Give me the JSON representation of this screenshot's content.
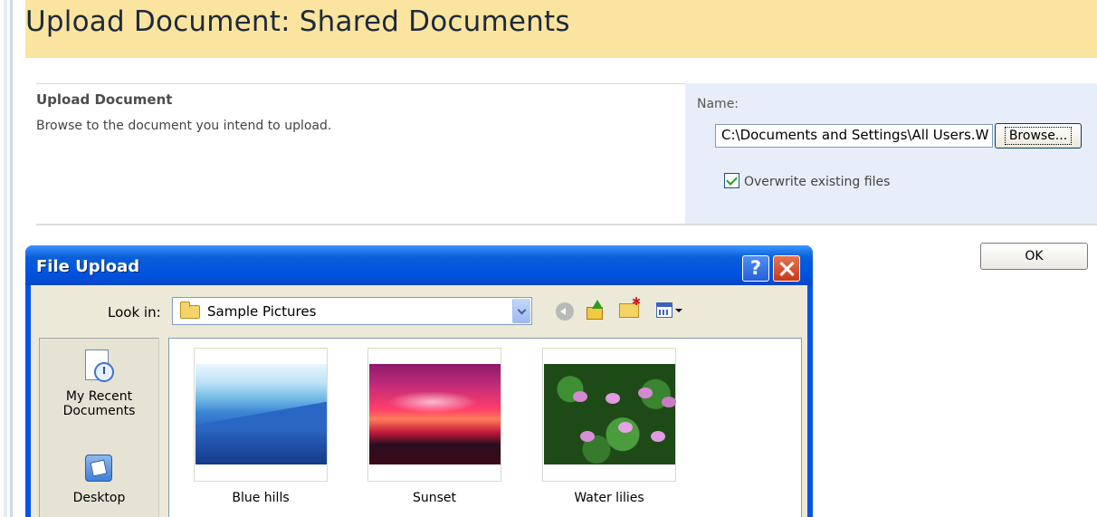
{
  "page": {
    "title": "Upload Document: Shared Documents"
  },
  "upload_section": {
    "heading": "Upload Document",
    "description": "Browse to the document you intend to upload.",
    "name_label": "Name:",
    "path_value": "C:\\Documents and Settings\\All Users.W",
    "browse_label": "Browse...",
    "overwrite_label": "Overwrite existing files",
    "overwrite_checked": true
  },
  "actions": {
    "ok_label": "OK"
  },
  "dialog": {
    "title": "File Upload",
    "help_label": "?",
    "lookin_label": "Look in:",
    "lookin_value": "Sample Pictures",
    "places": [
      {
        "label_line1": "My Recent",
        "label_line2": "Documents",
        "icon": "recent-documents-icon"
      },
      {
        "label_line1": "Desktop",
        "icon": "desktop-icon"
      }
    ],
    "files": [
      {
        "name": "Blue hills",
        "icon": "image-thumbnail"
      },
      {
        "name": "Sunset",
        "icon": "image-thumbnail"
      },
      {
        "name": "Water lilies",
        "icon": "image-thumbnail"
      }
    ],
    "toolbar_icons": [
      "back-icon",
      "up-folder-icon",
      "new-folder-icon",
      "views-menu-icon"
    ]
  },
  "colors": {
    "title_bar_bg": "#fbe4a0",
    "panel_bg": "#e7eef9",
    "dialog_blue": "#0055e5",
    "dialog_body": "#ece9d8"
  }
}
